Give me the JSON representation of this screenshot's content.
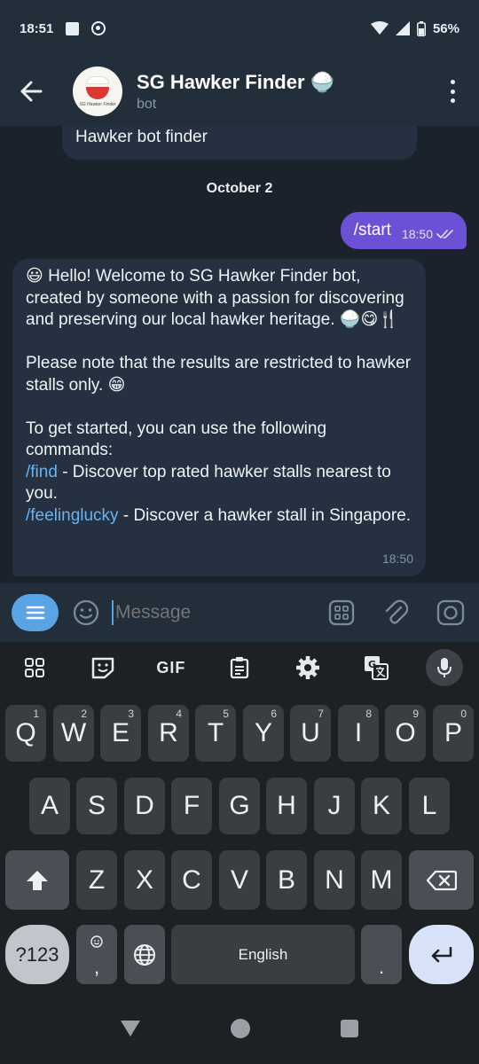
{
  "status_bar": {
    "time": "18:51",
    "battery": "56%"
  },
  "header": {
    "title": "SG Hawker Finder 🍚",
    "subtitle": "bot",
    "avatar_text": "SG Hawker Finder"
  },
  "chat": {
    "previous_message": "Hawker bot finder",
    "date_separator": "October 2",
    "outgoing": {
      "text": "/start",
      "time": "18:50"
    },
    "incoming": {
      "line1": "😃 Hello! Welcome to SG Hawker Finder bot, created by someone with a passion for discovering and preserving our local hawker heritage. 🍚😋🍴",
      "line2": "Please note that the results are restricted to hawker stalls only. 😁",
      "line3": "To get started, you can use the following commands:",
      "cmd_find": "/find",
      "cmd_find_desc": " - Discover top rated hawker stalls nearest to you.",
      "cmd_lucky": "/feelinglucky",
      "cmd_lucky_desc": " - Discover a hawker stall in Singapore.",
      "time": "18:50"
    }
  },
  "composer": {
    "placeholder": "Message"
  },
  "keyboard": {
    "toolbar": {
      "gif_label": "GIF"
    },
    "row1": [
      {
        "k": "Q",
        "n": "1"
      },
      {
        "k": "W",
        "n": "2"
      },
      {
        "k": "E",
        "n": "3"
      },
      {
        "k": "R",
        "n": "4"
      },
      {
        "k": "T",
        "n": "5"
      },
      {
        "k": "Y",
        "n": "6"
      },
      {
        "k": "U",
        "n": "7"
      },
      {
        "k": "I",
        "n": "8"
      },
      {
        "k": "O",
        "n": "9"
      },
      {
        "k": "P",
        "n": "0"
      }
    ],
    "row2": [
      "A",
      "S",
      "D",
      "F",
      "G",
      "H",
      "J",
      "K",
      "L"
    ],
    "row3": [
      "Z",
      "X",
      "C",
      "V",
      "B",
      "N",
      "M"
    ],
    "symbols_label": "?123",
    "comma": ",",
    "space_label": "English",
    "period": "."
  }
}
